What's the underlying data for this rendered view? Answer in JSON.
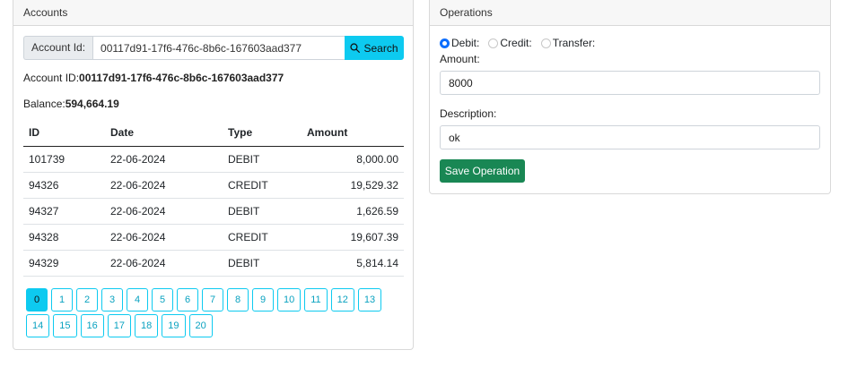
{
  "accounts": {
    "header": "Accounts",
    "search": {
      "label": "Account Id:",
      "value": "00117d91-17f6-476c-8b6c-167603aad377",
      "button_label": "Search",
      "button_icon": "search-icon"
    },
    "account_id_label": "Account ID:",
    "account_id_value": "00117d91-17f6-476c-8b6c-167603aad377",
    "balance_label": "Balance:",
    "balance_value": "594,664.19",
    "table": {
      "columns": [
        "ID",
        "Date",
        "Type",
        "Amount"
      ],
      "rows": [
        [
          "101739",
          "22-06-2024",
          "DEBIT",
          "8,000.00"
        ],
        [
          "94326",
          "22-06-2024",
          "CREDIT",
          "19,529.32"
        ],
        [
          "94327",
          "22-06-2024",
          "DEBIT",
          "1,626.59"
        ],
        [
          "94328",
          "22-06-2024",
          "CREDIT",
          "19,607.39"
        ],
        [
          "94329",
          "22-06-2024",
          "DEBIT",
          "5,814.14"
        ]
      ]
    },
    "pages": [
      "0",
      "1",
      "2",
      "3",
      "4",
      "5",
      "6",
      "7",
      "8",
      "9",
      "10",
      "11",
      "12",
      "13",
      "14",
      "15",
      "16",
      "17",
      "18",
      "19",
      "20"
    ],
    "active_page": "0"
  },
  "operations": {
    "header": "Operations",
    "radios": [
      {
        "label": "Debit:",
        "checked": true
      },
      {
        "label": "Credit:",
        "checked": false
      },
      {
        "label": "Transfer:",
        "checked": false
      }
    ],
    "amount_label": "Amount:",
    "amount_value": "8000",
    "description_label": "Description:",
    "description_value": "ok",
    "save_label": "Save Operation"
  },
  "colors": {
    "info": "#0dcaf0",
    "success": "#198754",
    "primary": "#0d6efd"
  }
}
